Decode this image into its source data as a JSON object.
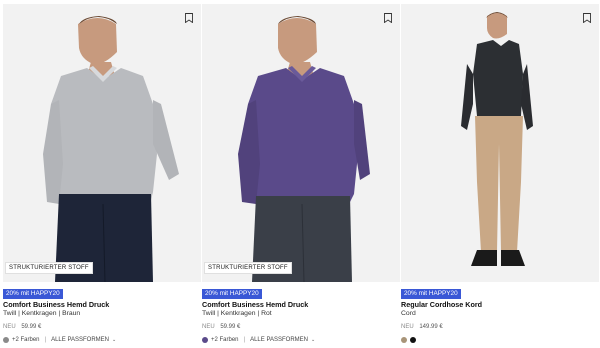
{
  "products": [
    {
      "badge": "STRUKTURIERTER STOFF",
      "promo": "20% mit HAPPY20",
      "title": "Comfort Business Hemd Druck",
      "subtitle": "Twill | Kentkragen | Braun",
      "price_prefix": "NEU",
      "price": "59.99 €",
      "swatch_color": "#8a8a8a",
      "more_colors": "+2 Farben",
      "fit_label": "ALLE PASSFORMEN"
    },
    {
      "badge": "STRUKTURIERTER STOFF",
      "promo": "20% mit HAPPY20",
      "title": "Comfort Business Hemd Druck",
      "subtitle": "Twill | Kentkragen | Rot",
      "price_prefix": "NEU",
      "price": "59.99 €",
      "swatch_color": "#5a4a8a",
      "more_colors": "+2 Farben",
      "fit_label": "ALLE PASSFORMEN"
    },
    {
      "promo": "20% mit HAPPY20",
      "title": "Regular Cordhose Kord",
      "subtitle": "Cord",
      "price_prefix": "NEU",
      "price": "149.99 €",
      "swatch_colors": [
        "#a89478",
        "#111111"
      ]
    }
  ],
  "colors": {
    "promo_bg": "#3a58d6",
    "image_bg": "#f2f2f2"
  },
  "icons": {
    "bookmark": "bookmark-icon",
    "chevron": "chevron-down-icon"
  }
}
